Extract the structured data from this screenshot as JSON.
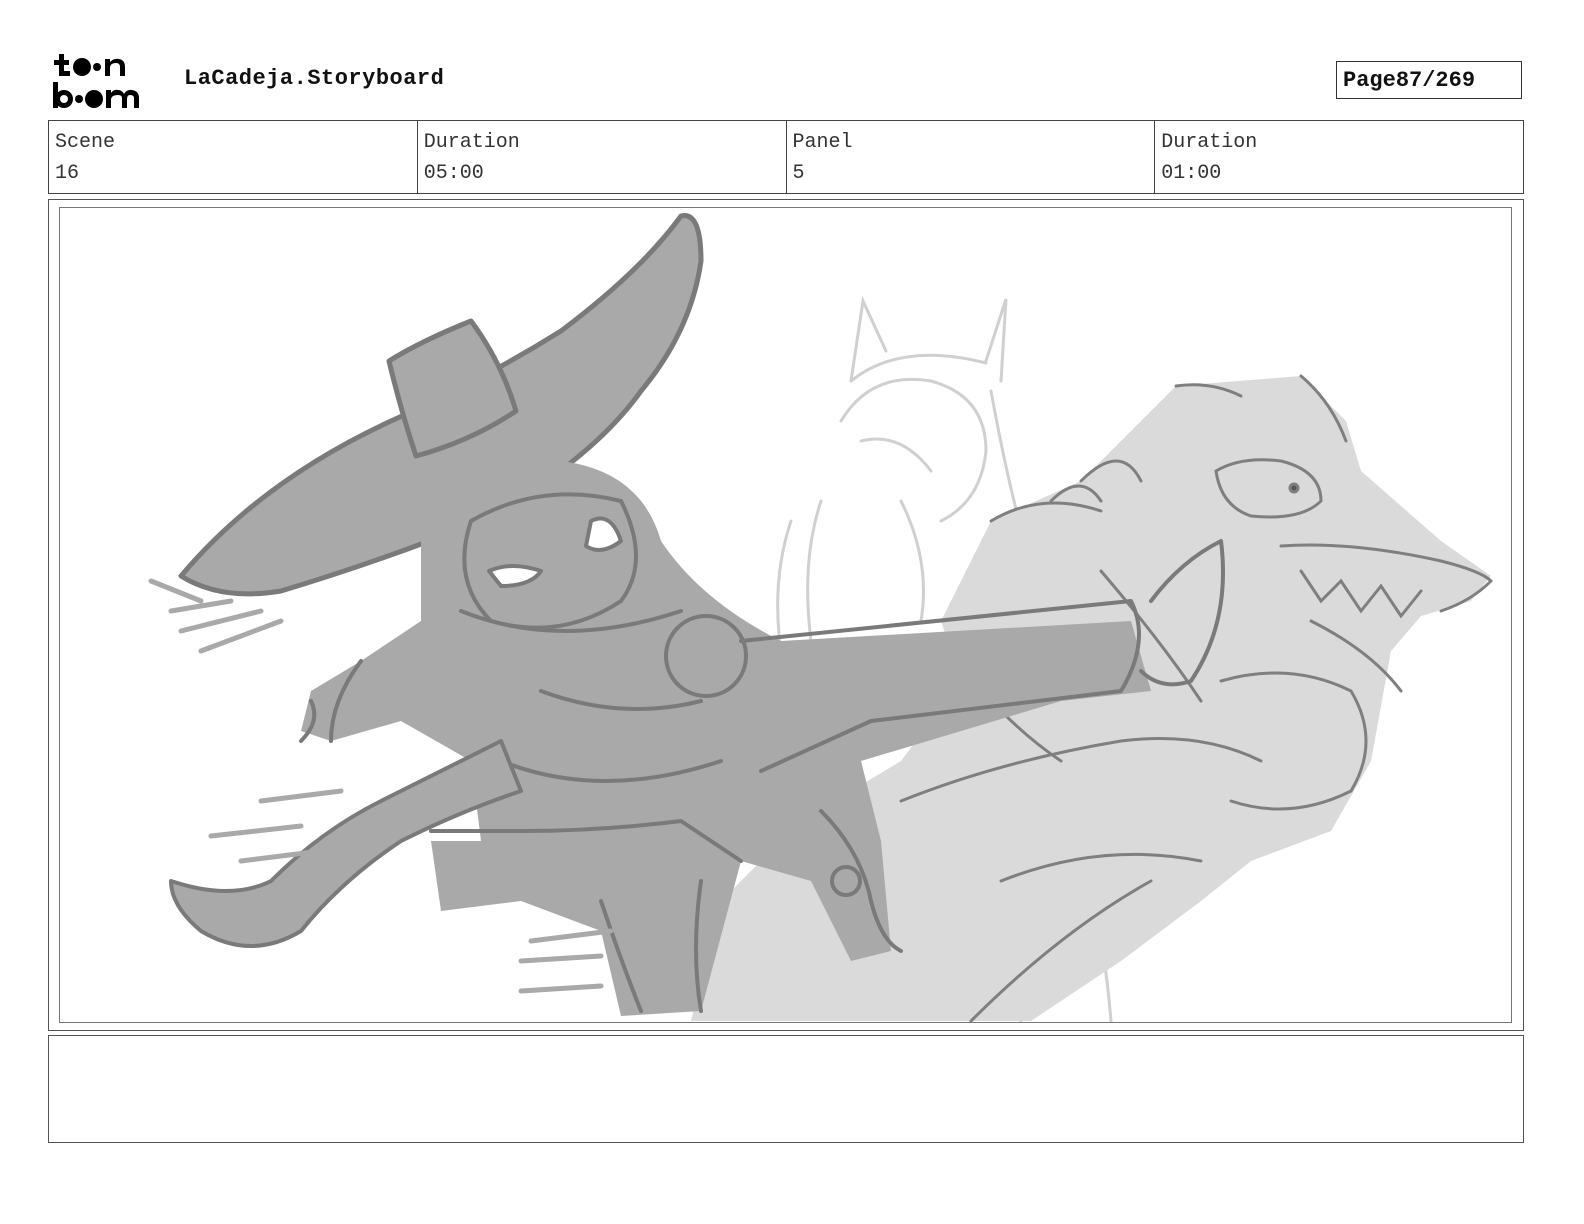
{
  "header": {
    "logo_alt": "toon boom",
    "title": "LaCadeja.Storyboard",
    "page_label": "Page",
    "page_value": "87/269"
  },
  "info": {
    "scene_label": "Scene",
    "scene_value": "16",
    "scene_duration_label": "Duration",
    "scene_duration_value": "05:00",
    "panel_label": "Panel",
    "panel_value": "5",
    "panel_duration_label": "Duration",
    "panel_duration_value": "01:00"
  },
  "notes": {
    "text": ""
  },
  "colors": {
    "sketch_dark": "#7a7a7a",
    "fill_mid": "#a9a9a9",
    "fill_light": "#d9d9d9",
    "ghost_line": "#cfcfcf"
  }
}
